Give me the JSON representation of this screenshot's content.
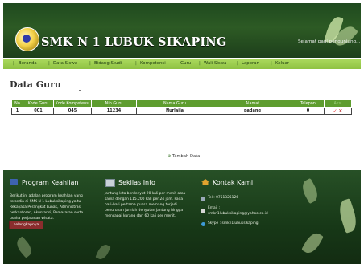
{
  "header": {
    "site_title": "SMK N 1 LUBUK SIKAPING",
    "welcome": "Selamat pagi pengunjung..."
  },
  "nav": [
    {
      "label": "Beranda"
    },
    {
      "label": "Data Siswa"
    },
    {
      "label": "Bidang Studi"
    },
    {
      "label": "Kompetensi"
    },
    {
      "label": "Guru"
    },
    {
      "label": "Wali Siswa"
    },
    {
      "label": "Laporan"
    },
    {
      "label": "Keluar"
    }
  ],
  "page_title": "Data Guru",
  "table": {
    "headers": [
      "No",
      "Kode Guru",
      "Kode Kompetensi",
      "Nip Guru",
      "Nama Guru",
      "Alamat",
      "Telepon",
      "Aksi"
    ],
    "rows": [
      [
        "1",
        "001",
        "045",
        "11234",
        "Nurlaila",
        "padang",
        "0"
      ]
    ]
  },
  "tambah_label": "Tambah Data",
  "footer": {
    "program": {
      "title": "Program Keahlian",
      "text": "Berikut ini adalah program keahlian yang tersedia di SMK N 1 Lubuksikaping yaitu Rekayasa Perangkat Lunak, Administrasi perkantoran, Akuntansi, Pemasaran serta usaha perjalanan wisata.",
      "button": "selengkapnya"
    },
    "sekilas": {
      "title": "Sekilas Info",
      "text": "Jantung kita berdenyut 90 kali per menit atau sama dengan 115.200 kali per 24 jam. Pada hari-hari pertama puasa memang terjadi penurunan jumlah denyutan jantung hingga mencapai kurang dari 60 kali per menit."
    },
    "kontak": {
      "title": "Kontak Kami",
      "tel": "Tel : 0751325126",
      "email_label": "Email :",
      "email": "smkn1lubuksikaping@yahoo.co.id",
      "skype": "Skype : smkn1lubuksikaping"
    }
  },
  "colors": {
    "header_green": "#2d5a24",
    "nav_green": "#a9d85c",
    "table_header_green": "#5e9d2f",
    "action_edit": "#ea3b3b",
    "action_delete": "#b10f0f"
  },
  "icons": {
    "logo": "school-emblem",
    "edit": "check-icon",
    "delete": "x-icon"
  }
}
